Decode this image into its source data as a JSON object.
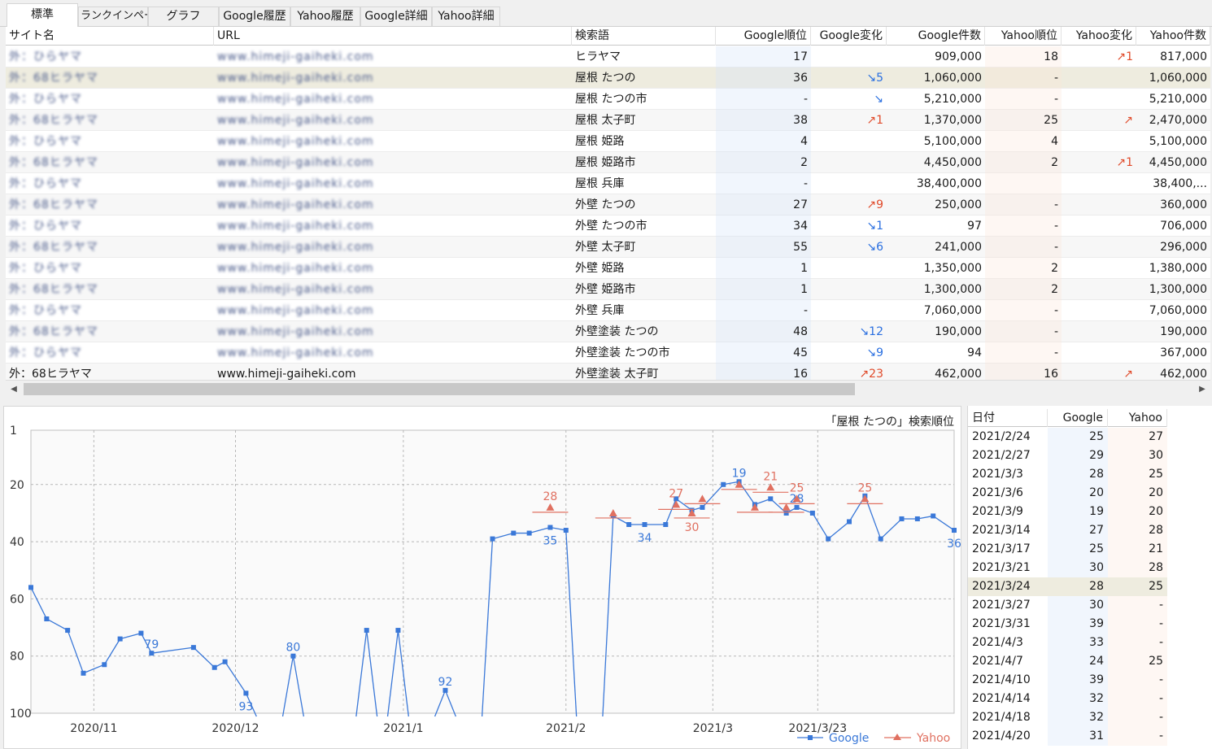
{
  "tabs": [
    {
      "label": "標準",
      "active": true
    },
    {
      "label": "ランクインページ",
      "active": false
    },
    {
      "label": "グラフ",
      "active": false
    },
    {
      "label": "Google履歴",
      "active": false
    },
    {
      "label": "Yahoo履歴",
      "active": false
    },
    {
      "label": "Google詳細",
      "active": false
    },
    {
      "label": "Yahoo詳細",
      "active": false
    }
  ],
  "table": {
    "columns": {
      "site": "サイト名",
      "url": "URL",
      "keyword": "検索語",
      "g_rank": "Google順位",
      "g_change": "Google変化",
      "g_count": "Google件数",
      "y_rank": "Yahoo順位",
      "y_change": "Yahoo変化",
      "y_count": "Yahoo件数"
    },
    "rows": [
      {
        "site": "外：ひらヤマ",
        "url": "www.himeji-gaiheki.com",
        "keyword": "ヒラヤマ",
        "g_rank": "17",
        "g_change": "",
        "g_count": "909,000",
        "y_rank": "18",
        "y_change": "↗1",
        "y_count": "817,000"
      },
      {
        "site": "外：68ヒラヤマ",
        "url": "www.himeji-gaiheki.com",
        "keyword": "屋根 たつの",
        "g_rank": "36",
        "g_change": "↘5",
        "g_count": "1,060,000",
        "y_rank": "-",
        "y_change": "",
        "y_count": "1,060,000",
        "selected": true
      },
      {
        "site": "外：ひらヤマ",
        "url": "www.himeji-gaiheki.com",
        "keyword": "屋根 たつの市",
        "g_rank": "-",
        "g_change": "↘",
        "g_count": "5,210,000",
        "y_rank": "-",
        "y_change": "",
        "y_count": "5,210,000"
      },
      {
        "site": "外：68ヒラヤマ",
        "url": "www.himeji-gaiheki.com",
        "keyword": "屋根 太子町",
        "g_rank": "38",
        "g_change": "↗1",
        "g_count": "1,370,000",
        "y_rank": "25",
        "y_change": "↗",
        "y_count": "2,470,000"
      },
      {
        "site": "外：ひらヤマ",
        "url": "www.himeji-gaiheki.com",
        "keyword": "屋根 姫路",
        "g_rank": "4",
        "g_change": "",
        "g_count": "5,100,000",
        "y_rank": "4",
        "y_change": "",
        "y_count": "5,100,000"
      },
      {
        "site": "外：68ヒラヤマ",
        "url": "www.himeji-gaiheki.com",
        "keyword": "屋根 姫路市",
        "g_rank": "2",
        "g_change": "",
        "g_count": "4,450,000",
        "y_rank": "2",
        "y_change": "↗1",
        "y_count": "4,450,000"
      },
      {
        "site": "外：ひらヤマ",
        "url": "www.himeji-gaiheki.com",
        "keyword": "屋根 兵庫",
        "g_rank": "-",
        "g_change": "",
        "g_count": "38,400,000",
        "y_rank": "",
        "y_change": "",
        "y_count": "38,400,..."
      },
      {
        "site": "外：68ヒラヤマ",
        "url": "www.himeji-gaiheki.com",
        "keyword": "外壁 たつの",
        "g_rank": "27",
        "g_change": "↗9",
        "g_count": "250,000",
        "y_rank": "-",
        "y_change": "",
        "y_count": "360,000"
      },
      {
        "site": "外：ひらヤマ",
        "url": "www.himeji-gaiheki.com",
        "keyword": "外壁 たつの市",
        "g_rank": "34",
        "g_change": "↘1",
        "g_count": "97",
        "y_rank": "-",
        "y_change": "",
        "y_count": "706,000"
      },
      {
        "site": "外：68ヒラヤマ",
        "url": "www.himeji-gaiheki.com",
        "keyword": "外壁 太子町",
        "g_rank": "55",
        "g_change": "↘6",
        "g_count": "241,000",
        "y_rank": "-",
        "y_change": "",
        "y_count": "296,000"
      },
      {
        "site": "外：ひらヤマ",
        "url": "www.himeji-gaiheki.com",
        "keyword": "外壁 姫路",
        "g_rank": "1",
        "g_change": "",
        "g_count": "1,350,000",
        "y_rank": "2",
        "y_change": "",
        "y_count": "1,380,000"
      },
      {
        "site": "外：68ヒラヤマ",
        "url": "www.himeji-gaiheki.com",
        "keyword": "外壁 姫路市",
        "g_rank": "1",
        "g_change": "",
        "g_count": "1,300,000",
        "y_rank": "2",
        "y_change": "",
        "y_count": "1,300,000"
      },
      {
        "site": "外：ひらヤマ",
        "url": "www.himeji-gaiheki.com",
        "keyword": "外壁 兵庫",
        "g_rank": "-",
        "g_change": "",
        "g_count": "7,060,000",
        "y_rank": "-",
        "y_change": "",
        "y_count": "7,060,000"
      },
      {
        "site": "外：68ヒラヤマ",
        "url": "www.himeji-gaiheki.com",
        "keyword": "外壁塗装 たつの",
        "g_rank": "48",
        "g_change": "↘12",
        "g_count": "190,000",
        "y_rank": "-",
        "y_change": "",
        "y_count": "190,000"
      },
      {
        "site": "外：ひらヤマ",
        "url": "www.himeji-gaiheki.com",
        "keyword": "外壁塗装 たつの市",
        "g_rank": "45",
        "g_change": "↘9",
        "g_count": "94",
        "y_rank": "-",
        "y_change": "",
        "y_count": "367,000"
      },
      {
        "site": "外：68ヒラヤマ",
        "url": "www.himeji-gaiheki.com",
        "keyword": "外壁塗装 太子町",
        "g_rank": "16",
        "g_change": "↗23",
        "g_count": "462,000",
        "y_rank": "16",
        "y_change": "↗",
        "y_count": "462,000"
      }
    ]
  },
  "chart": {
    "title": "「屋根 たつの」検索順位",
    "legend": {
      "google": "Google",
      "yahoo": "Yahoo"
    },
    "colors": {
      "google": "#3a78d8",
      "yahoo": "#e07060"
    }
  },
  "chart_data": {
    "type": "line",
    "title": "「屋根 たつの」検索順位",
    "y_ticks": [
      "1",
      "20",
      "40",
      "60",
      "80",
      "100"
    ],
    "ylim": [
      100,
      1
    ],
    "y_inverted": true,
    "x_ticks": [
      {
        "label": "2020/11",
        "x": 12
      },
      {
        "label": "2020/12",
        "x": 39
      },
      {
        "label": "2021/1",
        "x": 71
      },
      {
        "label": "2021/2",
        "x": 102
      },
      {
        "label": "2021/3",
        "x": 130
      },
      {
        "label": "2021/3/23",
        "x": 150
      }
    ],
    "grid": true,
    "legend_position": "bottom-right",
    "series": [
      {
        "name": "Google",
        "points": [
          [
            0,
            56
          ],
          [
            3,
            67
          ],
          [
            7,
            71
          ],
          [
            10,
            86
          ],
          [
            14,
            83
          ],
          [
            17,
            74
          ],
          [
            21,
            72
          ],
          [
            23,
            79
          ],
          [
            31,
            77
          ],
          [
            35,
            84
          ],
          [
            37,
            82
          ],
          [
            41,
            93
          ],
          [
            50,
            80
          ],
          [
            64,
            71
          ],
          [
            70,
            71
          ],
          [
            79,
            92
          ],
          [
            88,
            39
          ],
          [
            92,
            37
          ],
          [
            95,
            37
          ],
          [
            99,
            35
          ],
          [
            102,
            36
          ],
          [
            111,
            31
          ],
          [
            114,
            34
          ],
          [
            117,
            34
          ],
          [
            121,
            34
          ],
          [
            123,
            25
          ],
          [
            126,
            29
          ],
          [
            128,
            28
          ],
          [
            132,
            20
          ],
          [
            135,
            19
          ],
          [
            138,
            27
          ],
          [
            141,
            25
          ],
          [
            144,
            30
          ],
          [
            146,
            28
          ],
          [
            149,
            30
          ],
          [
            152,
            39
          ],
          [
            156,
            33
          ],
          [
            159,
            24
          ],
          [
            162,
            39
          ],
          [
            166,
            32
          ],
          [
            169,
            32
          ],
          [
            172,
            31
          ],
          [
            176,
            36
          ]
        ],
        "labels": [
          [
            23,
            79,
            "79"
          ],
          [
            41,
            93,
            "93"
          ],
          [
            50,
            80,
            "80"
          ],
          [
            79,
            92,
            "92"
          ],
          [
            99,
            35,
            "35"
          ],
          [
            117,
            34,
            "34"
          ],
          [
            135,
            19,
            "19"
          ],
          [
            146,
            28,
            "28"
          ],
          [
            176,
            36,
            "36"
          ]
        ],
        "breaks": [
          [
            41,
            50
          ],
          [
            50,
            64
          ],
          [
            64,
            70
          ],
          [
            70,
            79
          ],
          [
            79,
            88
          ],
          [
            102,
            111
          ]
        ]
      },
      {
        "name": "Yahoo",
        "points": [
          [
            99,
            28
          ],
          [
            111,
            30
          ],
          [
            123,
            27
          ],
          [
            126,
            30
          ],
          [
            128,
            25
          ],
          [
            135,
            20
          ],
          [
            138,
            28
          ],
          [
            141,
            21
          ],
          [
            144,
            28
          ],
          [
            146,
            25
          ],
          [
            159,
            25
          ]
        ],
        "labels": [
          [
            99,
            28,
            "28"
          ],
          [
            123,
            27,
            "27"
          ],
          [
            126,
            30,
            "30"
          ],
          [
            141,
            21,
            "21"
          ],
          [
            146,
            25,
            "25"
          ],
          [
            159,
            25,
            "25"
          ]
        ]
      }
    ]
  },
  "side": {
    "columns": {
      "date": "日付",
      "google": "Google",
      "yahoo": "Yahoo"
    },
    "rows": [
      {
        "date": "2021/2/24",
        "google": "25",
        "yahoo": "27"
      },
      {
        "date": "2021/2/27",
        "google": "29",
        "yahoo": "30"
      },
      {
        "date": "2021/3/3",
        "google": "28",
        "yahoo": "25"
      },
      {
        "date": "2021/3/6",
        "google": "20",
        "yahoo": "20"
      },
      {
        "date": "2021/3/9",
        "google": "19",
        "yahoo": "20"
      },
      {
        "date": "2021/3/14",
        "google": "27",
        "yahoo": "28"
      },
      {
        "date": "2021/3/17",
        "google": "25",
        "yahoo": "21"
      },
      {
        "date": "2021/3/21",
        "google": "30",
        "yahoo": "28"
      },
      {
        "date": "2021/3/24",
        "google": "28",
        "yahoo": "25",
        "selected": true
      },
      {
        "date": "2021/3/27",
        "google": "30",
        "yahoo": "-"
      },
      {
        "date": "2021/3/31",
        "google": "39",
        "yahoo": "-"
      },
      {
        "date": "2021/4/3",
        "google": "33",
        "yahoo": "-"
      },
      {
        "date": "2021/4/7",
        "google": "24",
        "yahoo": "25"
      },
      {
        "date": "2021/4/10",
        "google": "39",
        "yahoo": "-"
      },
      {
        "date": "2021/4/14",
        "google": "32",
        "yahoo": "-"
      },
      {
        "date": "2021/4/18",
        "google": "32",
        "yahoo": "-"
      },
      {
        "date": "2021/4/20",
        "google": "31",
        "yahoo": "-"
      }
    ]
  }
}
